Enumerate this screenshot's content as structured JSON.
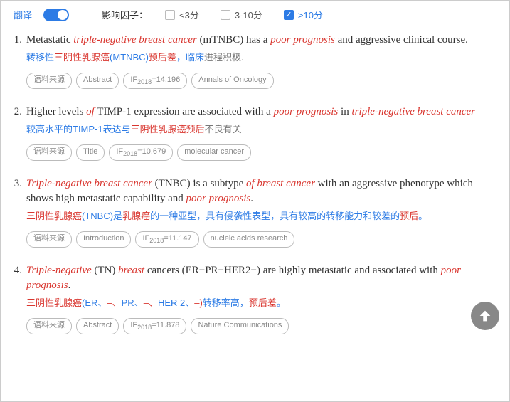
{
  "header": {
    "translate_label": "翻译",
    "filter_label": "影响因子：",
    "options": [
      {
        "label": "<3分",
        "checked": false
      },
      {
        "label": "3-10分",
        "checked": false
      },
      {
        "label": ">10分",
        "checked": true
      }
    ]
  },
  "items": [
    {
      "num": "1.",
      "en": [
        {
          "t": "Metastatic ",
          "r": 0
        },
        {
          "t": "triple-negative breast cancer",
          "r": 1
        },
        {
          "t": " (mTNBC) has a ",
          "r": 0
        },
        {
          "t": "poor prognosis",
          "r": 1
        },
        {
          "t": " and aggressive clinical course.",
          "r": 0
        }
      ],
      "cn": [
        {
          "t": "转移性",
          "c": "b"
        },
        {
          "t": "三阴性乳腺癌",
          "c": "r"
        },
        {
          "t": "(MTNBC)",
          "c": "b"
        },
        {
          "t": "预后差",
          "c": "r"
        },
        {
          "t": "，临床",
          "c": "b"
        },
        {
          "t": "进程积极.",
          "c": "g"
        }
      ],
      "tags": [
        "语料来源",
        "Abstract",
        "IF2018=14.196",
        "Annals of Oncology"
      ]
    },
    {
      "num": "2.",
      "en": [
        {
          "t": "Higher levels ",
          "r": 0
        },
        {
          "t": "of",
          "r": 1
        },
        {
          "t": " TIMP-1 expression are associated with a ",
          "r": 0
        },
        {
          "t": "poor prognosis",
          "r": 1
        },
        {
          "t": " in ",
          "r": 0
        },
        {
          "t": "triple-negative breast cancer",
          "r": 1
        }
      ],
      "cn": [
        {
          "t": "较高水平的TIMP-1表达与",
          "c": "b"
        },
        {
          "t": "三阴性乳腺癌预后",
          "c": "r"
        },
        {
          "t": "不良有关",
          "c": "g"
        }
      ],
      "tags": [
        "语料来源",
        "Title",
        "IF2018=10.679",
        "molecular cancer"
      ]
    },
    {
      "num": "3.",
      "en": [
        {
          "t": "Triple-negative breast cancer",
          "r": 1
        },
        {
          "t": " (TNBC) is a subtype ",
          "r": 0
        },
        {
          "t": "of breast cancer",
          "r": 1
        },
        {
          "t": " with an aggressive phenotype which shows high metastatic capability and ",
          "r": 0
        },
        {
          "t": "poor prognosis",
          "r": 1
        },
        {
          "t": ".",
          "r": 0
        }
      ],
      "cn": [
        {
          "t": "三阴性乳腺癌",
          "c": "r"
        },
        {
          "t": "(TNBC)是",
          "c": "b"
        },
        {
          "t": "乳腺癌",
          "c": "r"
        },
        {
          "t": "的一种亚型，具有侵袭性表型，具有较高的转移能力和较差的",
          "c": "b"
        },
        {
          "t": "预后",
          "c": "r"
        },
        {
          "t": "。",
          "c": "b"
        }
      ],
      "tags": [
        "语料来源",
        "Introduction",
        "IF2018=11.147",
        "nucleic acids research"
      ]
    },
    {
      "num": "4.",
      "en": [
        {
          "t": "Triple-negative",
          "r": 1
        },
        {
          "t": " (TN) ",
          "r": 0
        },
        {
          "t": "breast",
          "r": 1
        },
        {
          "t": " cancers (ER−PR−HER2−) are highly metastatic and associated with ",
          "r": 0
        },
        {
          "t": "poor prognosis",
          "r": 1
        },
        {
          "t": ".",
          "r": 0
        }
      ],
      "cn": [
        {
          "t": "三阴性乳腺癌",
          "c": "r"
        },
        {
          "t": "(ER、",
          "c": "b"
        },
        {
          "t": "–、",
          "c": "r"
        },
        {
          "t": "PR、",
          "c": "b"
        },
        {
          "t": "–、",
          "c": "r"
        },
        {
          "t": "HER 2、",
          "c": "b"
        },
        {
          "t": "–)",
          "c": "r"
        },
        {
          "t": "转移率高，",
          "c": "b"
        },
        {
          "t": "预后差",
          "c": "r"
        },
        {
          "t": "。",
          "c": "b"
        }
      ],
      "tags": [
        "语料来源",
        "Abstract",
        "IF2018=11.878",
        "Nature Communications"
      ]
    }
  ]
}
